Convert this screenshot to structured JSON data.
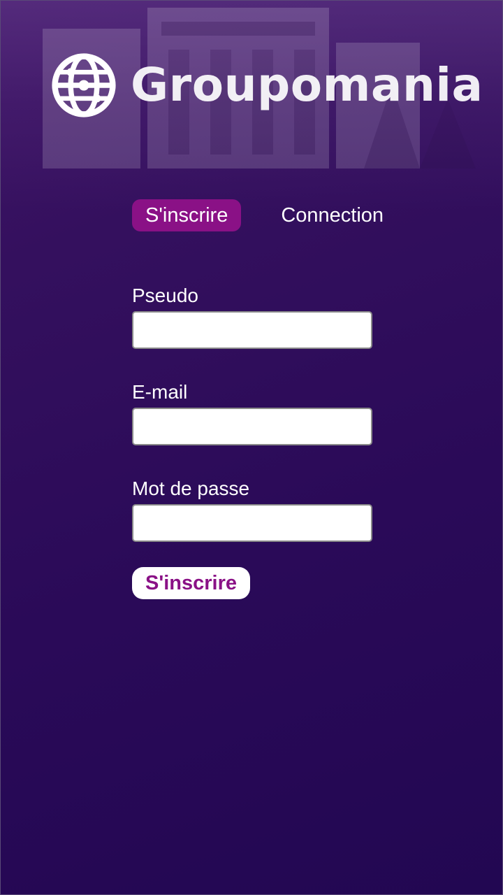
{
  "brand": {
    "name": "Groupomania",
    "logo_icon": "globe-icon"
  },
  "tabs": [
    {
      "label": "S'inscrire",
      "active": true
    },
    {
      "label": "Connection",
      "active": false
    }
  ],
  "form": {
    "fields": [
      {
        "label": "Pseudo",
        "value": ""
      },
      {
        "label": "E-mail",
        "value": ""
      },
      {
        "label": "Mot de passe",
        "value": ""
      }
    ],
    "submit_label": "S'inscrire"
  },
  "colors": {
    "background_top": "#3f1466",
    "background_bottom": "#220752",
    "accent": "#8a1186",
    "text": "#ffffff"
  }
}
